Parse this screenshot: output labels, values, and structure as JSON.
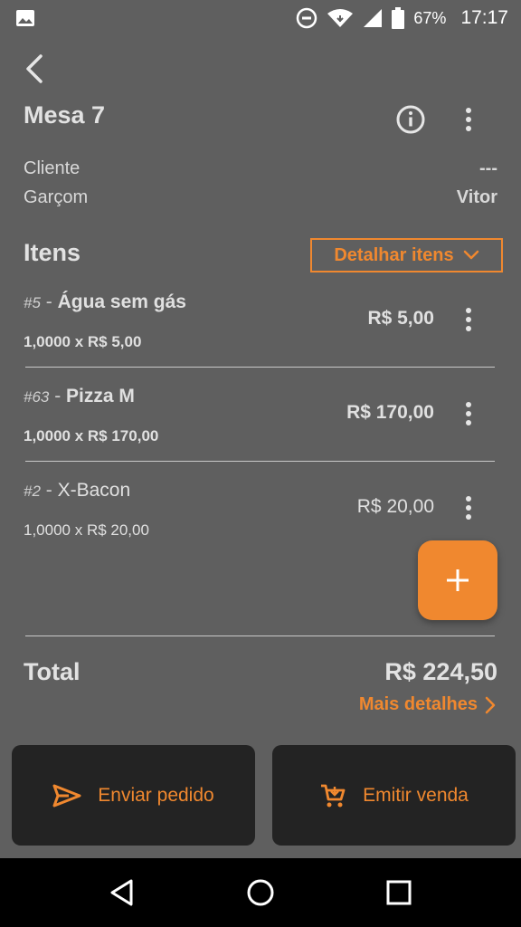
{
  "status_bar": {
    "battery": "67%",
    "time": "17:17",
    "icons": [
      "image-icon",
      "dnd-icon",
      "wifi-icon",
      "signal-icon",
      "battery-icon"
    ]
  },
  "header": {
    "title": "Mesa 7",
    "icons": [
      "back-icon",
      "info-icon",
      "more-vertical-icon"
    ]
  },
  "meta": {
    "client_label": "Cliente",
    "client_value": "---",
    "waiter_label": "Garçom",
    "waiter_value": "Vitor"
  },
  "items_section": {
    "title": "Itens",
    "detail_button": "Detalhar itens",
    "items": [
      {
        "code": "#5",
        "separator": " - ",
        "name": "Água sem gás",
        "qty_line": "1,0000 x R$ 5,00",
        "price": "R$ 5,00"
      },
      {
        "code": "#63",
        "separator": " - ",
        "name": "Pizza M",
        "qty_line": "1,0000 x R$ 170,00",
        "price": "R$ 170,00"
      },
      {
        "code": "#2",
        "separator": " - ",
        "name": "X-Bacon",
        "qty_line": "1,0000 x R$ 20,00",
        "price": "R$ 20,00"
      }
    ]
  },
  "summary": {
    "total_label": "Total",
    "total_value": "R$ 224,50",
    "more_details": "Mais detalhes"
  },
  "actions": {
    "send_order": "Enviar pedido",
    "issue_sale": "Emitir venda"
  },
  "colors": {
    "accent": "#f0882f",
    "background": "#5f5f5f",
    "button_bg": "#232323"
  }
}
